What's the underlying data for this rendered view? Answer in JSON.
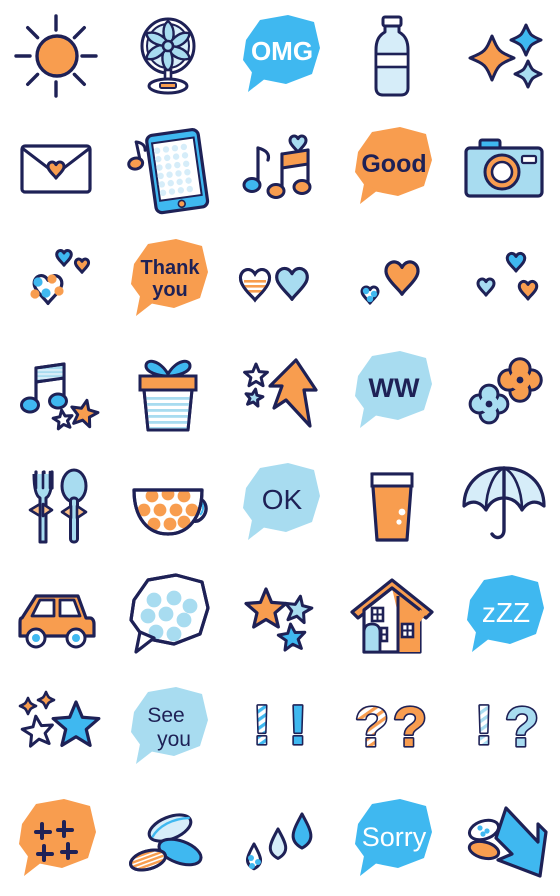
{
  "sheet": {
    "title": "Emoji Sticker Sheet",
    "columns": 5,
    "rows": 8,
    "cell_size": 112,
    "background": "#ffffff"
  },
  "palette": {
    "outline": "#1e2156",
    "orange": "#f89d4f",
    "orange_light": "#fbbf87",
    "blue_bright": "#3fb8f0",
    "blue_mid": "#4aa8e0",
    "blue_light": "#a8dcf0",
    "blue_pale": "#d6edf9",
    "white": "#ffffff"
  },
  "stickers": [
    {
      "row": 1,
      "col": 1,
      "name": "sun",
      "label": "Sun",
      "text": "",
      "text_color": "",
      "fill": "#f89d4f"
    },
    {
      "row": 1,
      "col": 2,
      "name": "electric-fan",
      "label": "Electric fan",
      "text": "",
      "text_color": "",
      "fill": "#a8dcf0"
    },
    {
      "row": 1,
      "col": 3,
      "name": "omg-bubble",
      "label": "OMG speech bubble",
      "text": "OMG",
      "text_color": "#ffffff",
      "fill": "#3fb8f0"
    },
    {
      "row": 1,
      "col": 4,
      "name": "water-bottle",
      "label": "Water bottle",
      "text": "",
      "text_color": "",
      "fill": "#a8dcf0"
    },
    {
      "row": 1,
      "col": 5,
      "name": "sparkles",
      "label": "Sparkles",
      "text": "",
      "text_color": "",
      "fill": "#f89d4f"
    },
    {
      "row": 2,
      "col": 1,
      "name": "love-letter",
      "label": "Love letter",
      "text": "",
      "text_color": "",
      "fill": "#ffffff"
    },
    {
      "row": 2,
      "col": 2,
      "name": "smartphone-music",
      "label": "Smartphone music",
      "text": "",
      "text_color": "",
      "fill": "#a8dcf0"
    },
    {
      "row": 2,
      "col": 3,
      "name": "music-notes-heart",
      "label": "Music notes heart",
      "text": "",
      "text_color": "",
      "fill": "#f89d4f"
    },
    {
      "row": 2,
      "col": 4,
      "name": "good-bubble",
      "label": "Good speech bubble",
      "text": "Good",
      "text_color": "#1e2156",
      "fill": "#f89d4f"
    },
    {
      "row": 2,
      "col": 5,
      "name": "camera",
      "label": "Camera",
      "text": "",
      "text_color": "",
      "fill": "#a8dcf0"
    },
    {
      "row": 3,
      "col": 1,
      "name": "polka-dot-hearts",
      "label": "Polka dot hearts",
      "text": "",
      "text_color": "",
      "fill": "#3fb8f0"
    },
    {
      "row": 3,
      "col": 2,
      "name": "thankyou-bubble",
      "label": "Thank you bubble",
      "text": "Thank you",
      "text_color": "#1e2156",
      "fill": "#f89d4f"
    },
    {
      "row": 3,
      "col": 3,
      "name": "two-blue-hearts",
      "label": "Two blue hearts",
      "text": "",
      "text_color": "",
      "fill": "#a8dcf0"
    },
    {
      "row": 3,
      "col": 4,
      "name": "orange-heart",
      "label": "Orange heart",
      "text": "",
      "text_color": "",
      "fill": "#f89d4f"
    },
    {
      "row": 3,
      "col": 5,
      "name": "three-hearts",
      "label": "Three small hearts",
      "text": "",
      "text_color": "",
      "fill": "#3fb8f0"
    },
    {
      "row": 4,
      "col": 1,
      "name": "music-note-stars",
      "label": "Music note stars",
      "text": "",
      "text_color": "",
      "fill": "#3fb8f0"
    },
    {
      "row": 4,
      "col": 2,
      "name": "gift-box",
      "label": "Gift box",
      "text": "",
      "text_color": "",
      "fill": "#f89d4f"
    },
    {
      "row": 4,
      "col": 3,
      "name": "up-arrow-stars",
      "label": "Up arrow with stars",
      "text": "",
      "text_color": "",
      "fill": "#f89d4f"
    },
    {
      "row": 4,
      "col": 4,
      "name": "ww-bubble",
      "label": "WW speech bubble",
      "text": "WW",
      "text_color": "#1e2156",
      "fill": "#a8dcf0"
    },
    {
      "row": 4,
      "col": 5,
      "name": "two-flowers",
      "label": "Two flowers",
      "text": "",
      "text_color": "",
      "fill": "#f89d4f"
    },
    {
      "row": 5,
      "col": 1,
      "name": "fork-and-spoon",
      "label": "Fork and spoon",
      "text": "",
      "text_color": "",
      "fill": "#a8dcf0"
    },
    {
      "row": 5,
      "col": 2,
      "name": "teacup",
      "label": "Polka dot teacup",
      "text": "",
      "text_color": "",
      "fill": "#f89d4f"
    },
    {
      "row": 5,
      "col": 3,
      "name": "ok-bubble",
      "label": "OK speech bubble",
      "text": "OK",
      "text_color": "#1e2156",
      "fill": "#a8dcf0"
    },
    {
      "row": 5,
      "col": 4,
      "name": "juice-glass",
      "label": "Juice glass",
      "text": "",
      "text_color": "",
      "fill": "#f89d4f"
    },
    {
      "row": 5,
      "col": 5,
      "name": "umbrella",
      "label": "Umbrella",
      "text": "",
      "text_color": "",
      "fill": "#a8dcf0"
    },
    {
      "row": 6,
      "col": 1,
      "name": "car",
      "label": "Orange car",
      "text": "",
      "text_color": "",
      "fill": "#f89d4f"
    },
    {
      "row": 6,
      "col": 2,
      "name": "dotted-bubble",
      "label": "Polka dot bubble",
      "text": "",
      "text_color": "",
      "fill": "#a8dcf0"
    },
    {
      "row": 6,
      "col": 3,
      "name": "three-stars",
      "label": "Three stars",
      "text": "",
      "text_color": "",
      "fill": "#f89d4f"
    },
    {
      "row": 6,
      "col": 4,
      "name": "house",
      "label": "House",
      "text": "",
      "text_color": "",
      "fill": "#f89d4f"
    },
    {
      "row": 6,
      "col": 5,
      "name": "zzz-bubble",
      "label": "zZZ sleep bubble",
      "text": "zZZ",
      "text_color": "#ffffff",
      "fill": "#3fb8f0"
    },
    {
      "row": 7,
      "col": 1,
      "name": "shining-stars",
      "label": "Shining stars",
      "text": "",
      "text_color": "",
      "fill": "#3fb8f0"
    },
    {
      "row": 7,
      "col": 2,
      "name": "seeyou-bubble",
      "label": "See you bubble",
      "text": "See you",
      "text_color": "#1e2156",
      "fill": "#a8dcf0"
    },
    {
      "row": 7,
      "col": 3,
      "name": "double-exclamation",
      "label": "Double exclamation mark",
      "text": "!!",
      "text_color": "#3fb8f0",
      "fill": "#3fb8f0"
    },
    {
      "row": 7,
      "col": 4,
      "name": "double-question",
      "label": "Double question mark",
      "text": "??",
      "text_color": "#f89d4f",
      "fill": "#f89d4f"
    },
    {
      "row": 7,
      "col": 5,
      "name": "exclamation-question",
      "label": "Exclamation question mark",
      "text": "!?",
      "text_color": "#a8dcf0",
      "fill": "#a8dcf0"
    },
    {
      "row": 8,
      "col": 1,
      "name": "anger-bubble",
      "label": "Anger mark bubble",
      "text": "",
      "text_color": "#1e2156",
      "fill": "#f89d4f"
    },
    {
      "row": 8,
      "col": 2,
      "name": "leaves",
      "label": "Leaves",
      "text": "",
      "text_color": "",
      "fill": "#3fb8f0"
    },
    {
      "row": 8,
      "col": 3,
      "name": "water-drops",
      "label": "Water drops",
      "text": "",
      "text_color": "",
      "fill": "#3fb8f0"
    },
    {
      "row": 8,
      "col": 4,
      "name": "sorry-bubble",
      "label": "Sorry speech bubble",
      "text": "Sorry",
      "text_color": "#ffffff",
      "fill": "#3fb8f0"
    },
    {
      "row": 8,
      "col": 5,
      "name": "down-arrow-leaf",
      "label": "Down arrow with leaf",
      "text": "",
      "text_color": "",
      "fill": "#3fb8f0"
    }
  ]
}
